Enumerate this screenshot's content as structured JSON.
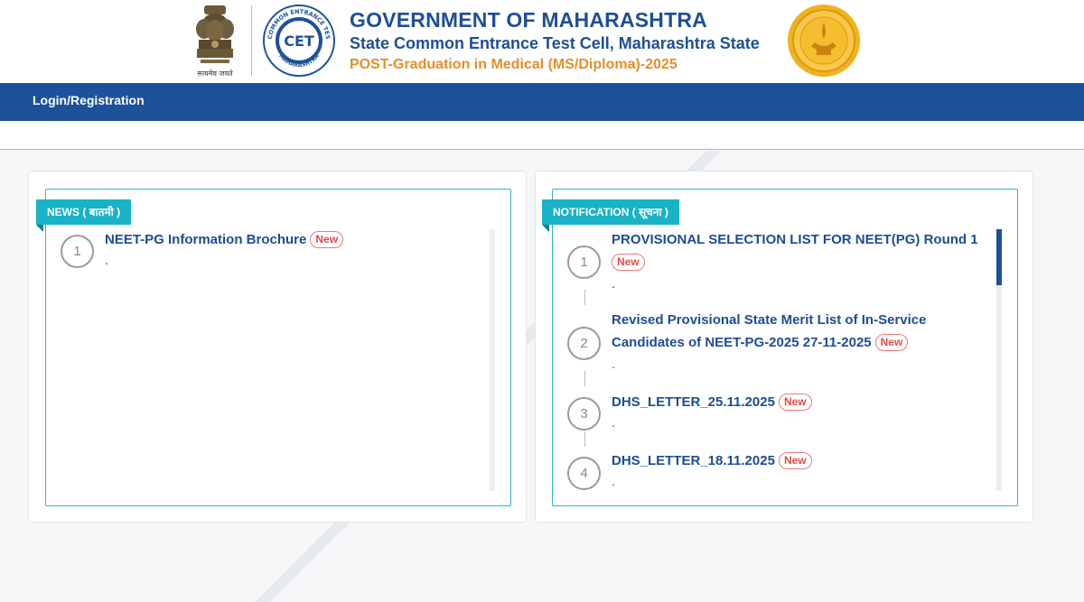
{
  "header": {
    "title": "GOVERNMENT OF MAHARASHTRA",
    "subtitle": "State Common Entrance Test Cell, Maharashtra State",
    "program": "POST-Graduation in Medical (MS/Diploma)-2025",
    "emblem_caption": "सत्यमेव जयते",
    "cet_logo_text": "CET",
    "cet_ring_top": "STATE COMMON ENTRANCE TEST CELL",
    "cet_ring_bottom": "MAHARASHTRA"
  },
  "nav": {
    "login_label": "Login/Registration"
  },
  "news": {
    "heading": "NEWS ( बातमी )",
    "items": [
      {
        "number": "1",
        "title": "NEET-PG Information Brochure",
        "badge": "New",
        "dot": "."
      }
    ]
  },
  "notification": {
    "heading": "NOTIFICATION ( सूचना )",
    "items": [
      {
        "number": "1",
        "title": "PROVISIONAL SELECTION LIST FOR NEET(PG) Round 1",
        "badge": "New",
        "dot": "."
      },
      {
        "number": "2",
        "title_line1": "Revised Provisional State Merit List of In-Service",
        "title_line2": "Candidates of NEET-PG-2025 27-11-2025",
        "badge": "New",
        "dot": "."
      },
      {
        "number": "3",
        "title": "DHS_LETTER_25.11.2025",
        "badge": "New",
        "dot": "."
      },
      {
        "number": "4",
        "title": "DHS_LETTER_18.11.2025",
        "badge": "New",
        "dot": "."
      }
    ]
  },
  "colors": {
    "brand_blue": "#1d5199",
    "accent_teal": "#19b2c6",
    "program_orange": "#e58e2a",
    "badge_red": "#e14c4c"
  }
}
